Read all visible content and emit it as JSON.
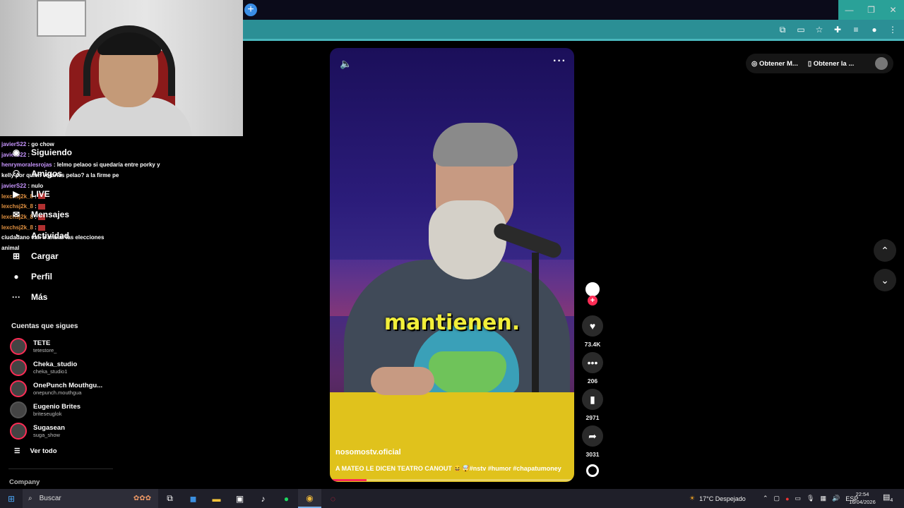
{
  "browser": {
    "new_tab": "+",
    "window_controls": [
      "—",
      "❐",
      "✕"
    ]
  },
  "chat": [
    {
      "user": "javierS22",
      "msg": " : go chow"
    },
    {
      "user": "javierS22",
      "msg": " : "
    },
    {
      "user": "henrymoralesrojas",
      "msg": " : Ielmo pelaoo si quedaría entre porky y"
    },
    {
      "user": "",
      "msg": "kelly por quien votarías pelao? a la firme pe"
    },
    {
      "user": "javierS22",
      "msg": " : nulo"
    },
    {
      "user": "lexchsj2k_8",
      "msg": " : ",
      "orange": true
    },
    {
      "user": "lexchsj2k_8",
      "msg": " : ",
      "orange": true
    },
    {
      "user": "lexchsj2k_8",
      "msg": " : ",
      "orange": true
    },
    {
      "user": "lexchsj2k_8",
      "msg": " : ",
      "orange": true
    },
    {
      "user": "",
      "msg": "ciudadano van a anular las elecciones"
    },
    {
      "user": "",
      "msg": "animal"
    }
  ],
  "sidebar": {
    "nav": [
      {
        "label": "Siguiendo",
        "icon": "following-icon"
      },
      {
        "label": "Amigos",
        "icon": "friends-icon"
      },
      {
        "label": "LIVE",
        "icon": "live-icon"
      },
      {
        "label": "Mensajes",
        "icon": "messages-icon"
      },
      {
        "label": "Actividad",
        "icon": "activity-icon"
      },
      {
        "label": "Cargar",
        "icon": "upload-icon"
      },
      {
        "label": "Perfil",
        "icon": "profile-icon"
      },
      {
        "label": "Más",
        "icon": "more-icon"
      }
    ],
    "following_title": "Cuentas que sigues",
    "accounts": [
      {
        "name": "TETE",
        "handle": "tetestore_"
      },
      {
        "name": "Cheka_studio",
        "handle": "cheka_studio1"
      },
      {
        "name": "OnePunch Mouthgu...",
        "handle": "onepunch.mouthgua"
      },
      {
        "name": "Eugenio Brites",
        "handle": "briteseuglok"
      },
      {
        "name": "Sugasean",
        "handle": "suga_show"
      }
    ],
    "see_all": "Ver todo",
    "company": "Company"
  },
  "video": {
    "caption": "mantienen.",
    "author": "nosomostv.oficial",
    "description": "A MATEO LE DICEN TEATRO CANOUT 😆🤯#nstv #humor #chapatumoney",
    "progress": 0.15
  },
  "actions": {
    "likes": "73.4K",
    "comments": "206",
    "saves": "2971",
    "shares": "3031"
  },
  "top_right": {
    "get_coins": "Obtener M...",
    "get_app": "Obtener la ..."
  },
  "taskbar": {
    "search_placeholder": "Buscar",
    "weather": "17°C  Despejado",
    "lang": "ESP",
    "time": "22:54",
    "date": "16/04/2026",
    "notifications": "4"
  },
  "colors": {
    "accent": "#fe2c55",
    "caption": "#f2ef3a",
    "address_bar": "#2b8f95"
  }
}
